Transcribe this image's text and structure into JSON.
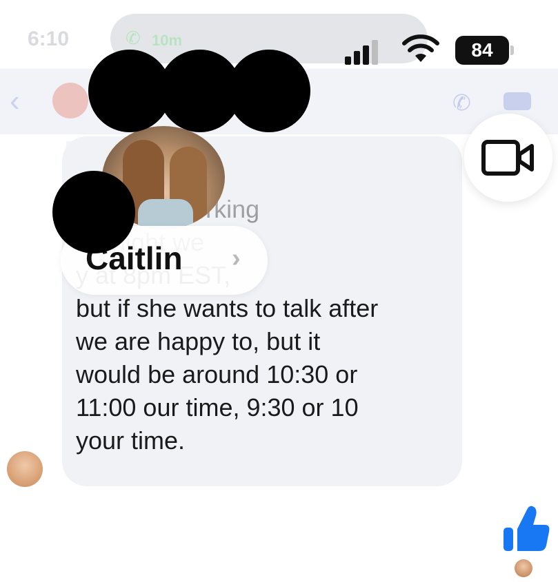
{
  "status_bar": {
    "time": "6:10",
    "call_duration": "10m",
    "battery": "84"
  },
  "profile": {
    "name": "Caitlin",
    "chevron": "›"
  },
  "message": {
    "text": "are both working\nr tonight we\ny at 8pm EST,\nbut if she wants to talk after\nwe are happy to, but it\nwould be around 10:30 or\n11:00 our time, 9:30 or 10\nyour time."
  },
  "icons": {
    "back": "chevron-left-icon",
    "phone": "phone-icon",
    "video": "video-camera-icon",
    "like": "thumbs-up-icon"
  },
  "colors": {
    "accent": "#1877f2",
    "bubble": "#f1f2f6",
    "header": "#f1f3f8"
  }
}
